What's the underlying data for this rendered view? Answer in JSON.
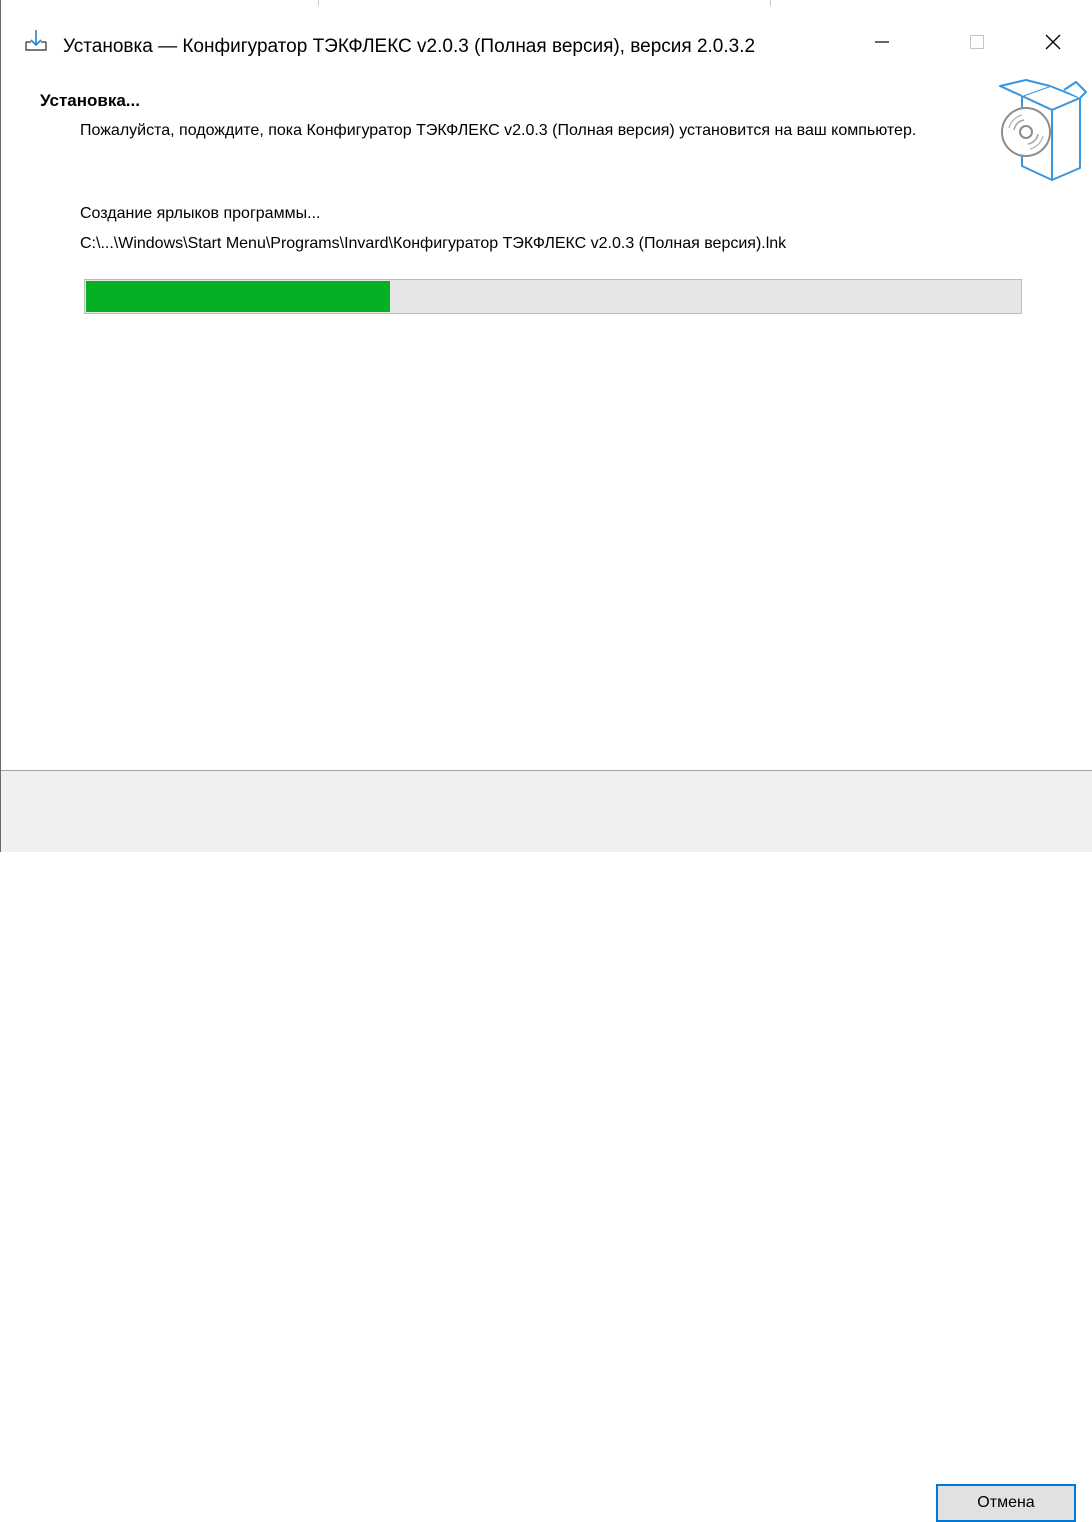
{
  "window": {
    "title": "Установка — Конфигуратор ТЭКФЛЕКС v2.0.3 (Полная версия), версия 2.0.3.2",
    "icon": "install-download-icon",
    "controls": [
      "minimize-icon",
      "maximize-icon",
      "close-icon"
    ]
  },
  "header": {
    "title": "Установка...",
    "description": "Пожалуйста, подождите, пока Конфигуратор ТЭКФЛЕКС v2.0.3 (Полная версия) установится на ваш компьютер.",
    "image": "software-box-disc-icon"
  },
  "progress": {
    "status": "Создание ярлыков программы...",
    "path": "C:\\...\\Windows\\Start Menu\\Programs\\Invard\\Конфигуратор ТЭКФЛЕКС v2.0.3 (Полная версия).lnk",
    "fraction": 0.325,
    "color": "#06b025"
  },
  "footer": {
    "cancel_label": "Отмена"
  }
}
